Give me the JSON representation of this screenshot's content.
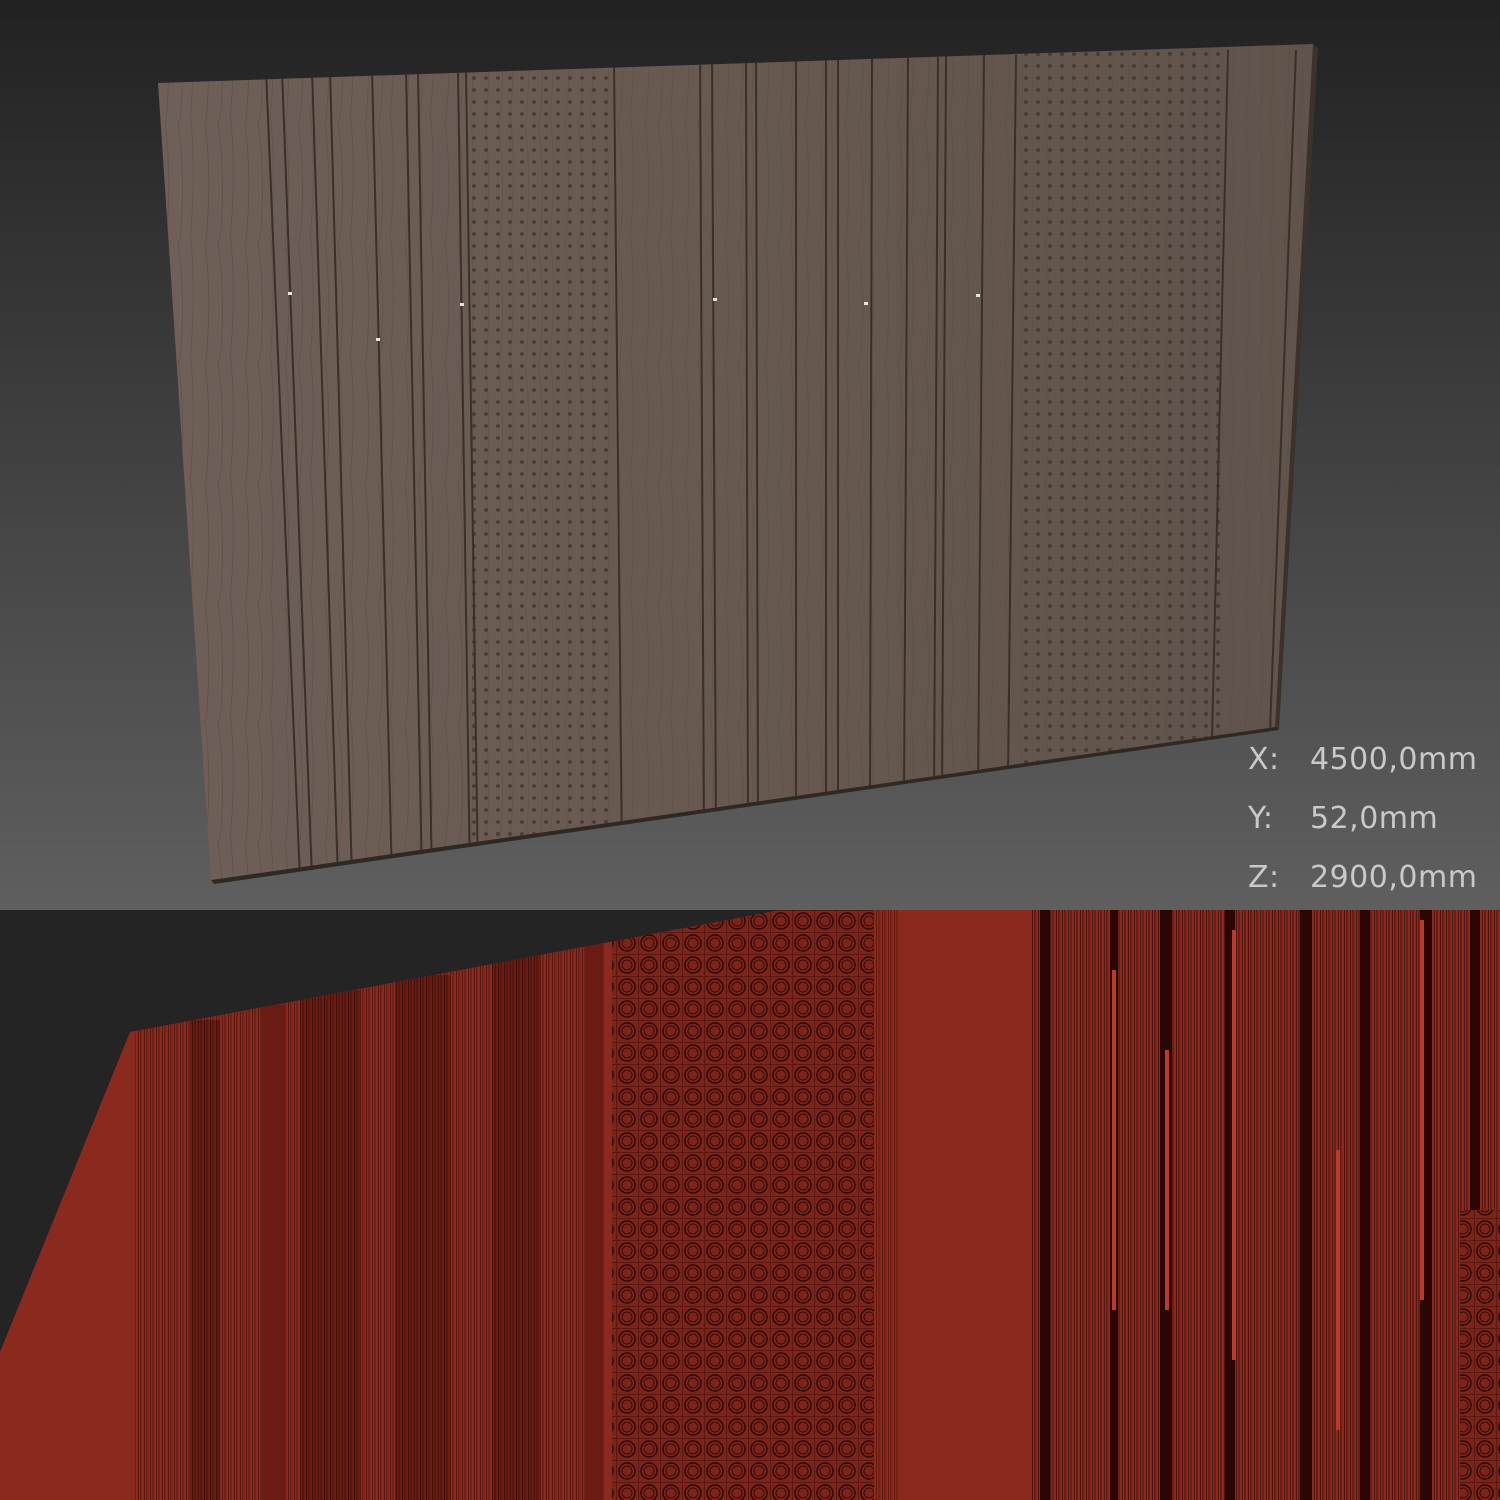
{
  "dimensions": {
    "x": {
      "label": "X:",
      "value": "4500,0mm"
    },
    "y": {
      "label": "Y: ",
      "value": "52,0mm"
    },
    "z": {
      "label": "Z:",
      "value": "2900,0mm"
    }
  },
  "colors": {
    "viewport_background_top": "#242424",
    "viewport_background_bottom": "#5e5e5e",
    "wood_panel": "#6b5d53",
    "wireframe_panel": "#8a2a1f",
    "wireframe_lines": "#2a0705"
  }
}
